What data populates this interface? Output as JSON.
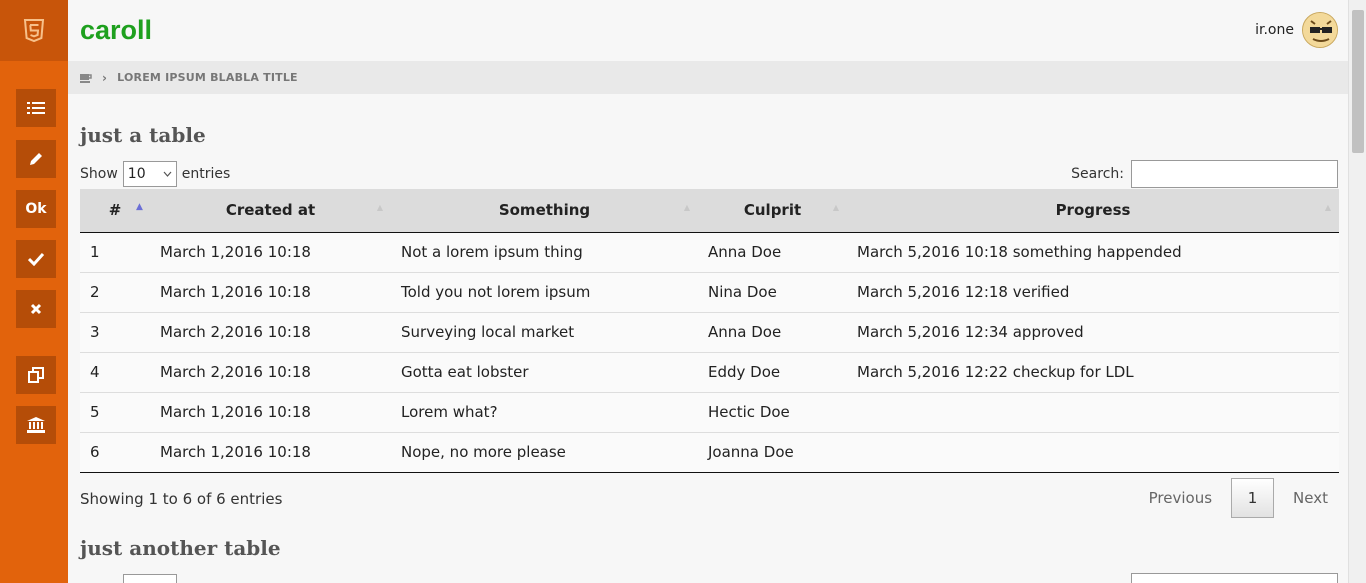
{
  "brand": {
    "name": "caroll"
  },
  "user": {
    "name": "ir.one"
  },
  "sidebar": {
    "items": [
      {
        "icon": "list-icon",
        "label": ""
      },
      {
        "icon": "pencil-icon",
        "label": ""
      },
      {
        "icon": "ok-text",
        "label": "Ok"
      },
      {
        "icon": "check-icon",
        "label": ""
      },
      {
        "icon": "close-icon",
        "label": ""
      },
      {
        "icon": "copy-icon",
        "label": ""
      },
      {
        "icon": "bank-icon",
        "label": ""
      }
    ]
  },
  "breadcrumb": {
    "title": "LOREM IPSUM BLABLA TITLE"
  },
  "tables": [
    {
      "title": "just a table",
      "show_label": "Show",
      "entries_value": "10",
      "entries_label": "entries",
      "search_label": "Search:",
      "columns": [
        "#",
        "Created at",
        "Something",
        "Culprit",
        "Progress"
      ],
      "rows": [
        [
          "1",
          "March 1,2016 10:18",
          "Not a lorem ipsum thing",
          "Anna Doe",
          "March 5,2016 10:18 something happended"
        ],
        [
          "2",
          "March 1,2016 10:18",
          "Told you not lorem ipsum",
          "Nina Doe",
          "March 5,2016 12:18 verified"
        ],
        [
          "3",
          "March 2,2016 10:18",
          "Surveying local market",
          "Anna Doe",
          "March 5,2016 12:34 approved"
        ],
        [
          "4",
          "March 2,2016 10:18",
          "Gotta eat lobster",
          "Eddy Doe",
          "March 5,2016 12:22 checkup for LDL"
        ],
        [
          "5",
          "March 1,2016 10:18",
          "Lorem what?",
          "Hectic Doe",
          ""
        ],
        [
          "6",
          "March 1,2016 10:18",
          "Nope, no more please",
          "Joanna Doe",
          ""
        ]
      ],
      "info": "Showing 1 to 6 of 6 entries",
      "pager": {
        "previous": "Previous",
        "current": "1",
        "next": "Next"
      }
    },
    {
      "title": "just another table"
    }
  ],
  "colors": {
    "sidebar": "#e2630c",
    "brand": "#1ea01e"
  }
}
